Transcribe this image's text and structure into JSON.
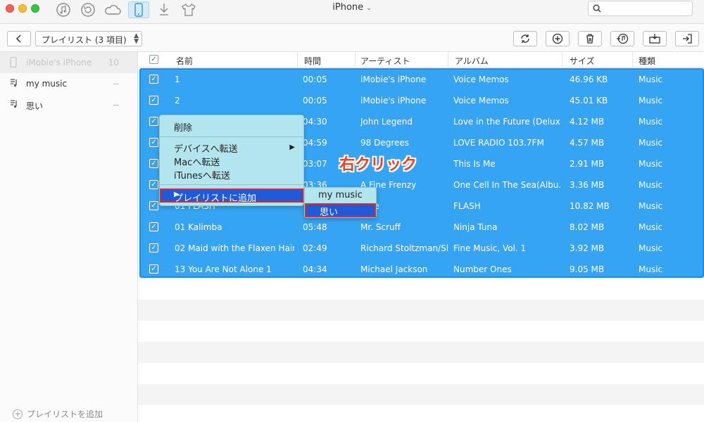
{
  "titlebar": {
    "title": "iPhone",
    "title_chevron": "⌄",
    "icons": [
      "music-icon",
      "restore-icon",
      "cloud-icon",
      "phone-icon",
      "download-icon",
      "tshirt-icon"
    ],
    "search": {
      "placeholder": "",
      "value": ""
    }
  },
  "toolbar": {
    "playlist_select": "プレイリスト (3 項目)",
    "actions": [
      "refresh-icon",
      "add-icon",
      "delete-icon",
      "to-itunes-icon",
      "to-computer-icon",
      "export-icon"
    ]
  },
  "sidebar": {
    "items": [
      {
        "label": "iMobie's iPhone",
        "count": "10"
      },
      {
        "label": "my music",
        "count": "--"
      },
      {
        "label": "思い",
        "count": "--"
      }
    ],
    "add_label": "プレイリストを追加"
  },
  "table": {
    "headers": [
      "名前",
      "時間",
      "アーティスト",
      "アルバム",
      "サイズ",
      "種類"
    ],
    "rows": [
      {
        "name": "1",
        "time": "00:05",
        "artist": "iMobie's iPhone",
        "album": "Voice Memos",
        "size": "46.96 KB",
        "type": "Music"
      },
      {
        "name": "2",
        "time": "00:05",
        "artist": "iMobie's iPhone",
        "album": "Voice Memos",
        "size": "45.01 KB",
        "type": "Music"
      },
      {
        "name": "",
        "time": "04:30",
        "artist": "John Legend",
        "album": "Love in the Future (Deluxe...",
        "size": "4.12 MB",
        "type": "Music"
      },
      {
        "name": "",
        "time": "04:59",
        "artist": "98 Degrees",
        "album": "LOVE RADIO 103.7FM",
        "size": "4.57 MB",
        "type": "Music"
      },
      {
        "name": "",
        "time": "03:07",
        "artist": "",
        "album": "This Is Me",
        "size": "2.91 MB",
        "type": "Music"
      },
      {
        "name": "",
        "time": "03:36",
        "artist": "A Fine Frenzy",
        "album": "One Cell In The Sea(Albu...",
        "size": "3.36 MB",
        "type": "Music"
      },
      {
        "name": "01 FLASH",
        "time": "",
        "artist": "ume",
        "album": "FLASH",
        "size": "10.82 MB",
        "type": "Music"
      },
      {
        "name": "01 Kalimba",
        "time": "05:48",
        "artist": "Mr. Scruff",
        "album": "Ninja Tuna",
        "size": "8.02 MB",
        "type": "Music"
      },
      {
        "name": "02 Maid with the Flaxen Hair",
        "time": "02:49",
        "artist": "Richard Stoltzman/Sl...",
        "album": "Fine Music, Vol. 1",
        "size": "3.92 MB",
        "type": "Music"
      },
      {
        "name": "13 You Are Not Alone 1",
        "time": "04:34",
        "artist": "Michael Jackson",
        "album": "Number Ones",
        "size": "9.05 MB",
        "type": "Music"
      }
    ]
  },
  "context_menu": {
    "delete": "削除",
    "to_device": "デバイスへ転送",
    "to_mac": "Macへ転送",
    "to_itunes": "iTunesへ転送",
    "add_to_playlist": "プレイリストに追加",
    "arrow": "▶"
  },
  "submenu": {
    "items": [
      "my music",
      "思い"
    ]
  },
  "annotation": "右クリック",
  "colors": {
    "selection": "#34a4f3",
    "menu": "#b3e5ee",
    "highlight": "#1f5bd8",
    "annotation": "#ef3e22"
  }
}
